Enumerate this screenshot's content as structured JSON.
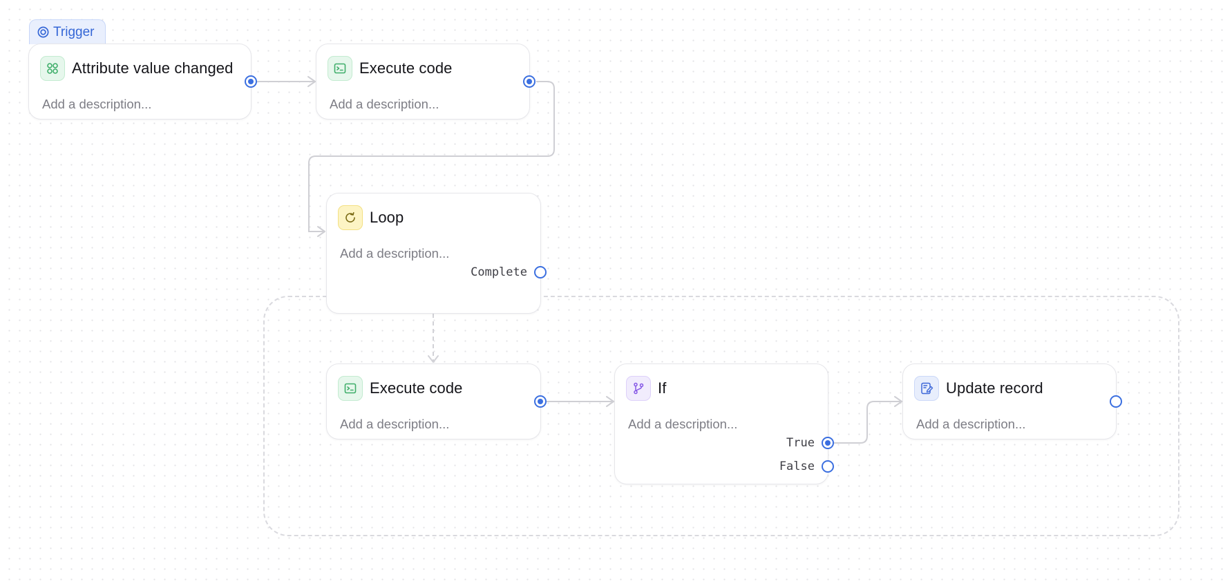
{
  "trigger_tag": {
    "label": "Trigger",
    "icon": "target-icon"
  },
  "nodes": {
    "attribute_changed": {
      "title": "Attribute value changed",
      "description": "Add a description...",
      "icon": "grid-icon"
    },
    "execute_code_1": {
      "title": "Execute code",
      "description": "Add a description...",
      "icon": "terminal-icon"
    },
    "loop": {
      "title": "Loop",
      "description": "Add a description...",
      "icon": "refresh-icon",
      "ports": {
        "complete": "Complete"
      }
    },
    "execute_code_2": {
      "title": "Execute code",
      "description": "Add a description...",
      "icon": "terminal-icon"
    },
    "if_node": {
      "title": "If",
      "description": "Add a description...",
      "icon": "branch-icon",
      "ports": {
        "true": "True",
        "false": "False"
      }
    },
    "update_record": {
      "title": "Update record",
      "description": "Add a description...",
      "icon": "edit-record-icon"
    }
  },
  "colors": {
    "port_accent": "#3b6fe0",
    "edge": "#cfcfd4",
    "trigger_accent": "#3466d6"
  }
}
